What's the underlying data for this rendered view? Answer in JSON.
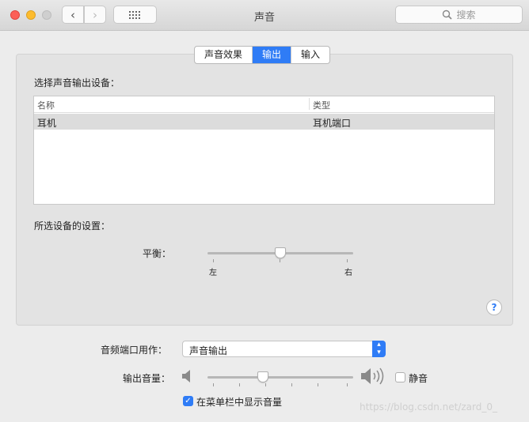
{
  "window": {
    "title": "声音"
  },
  "toolbar": {
    "back_icon": "‹",
    "forward_icon": "›",
    "grid_icon": "⋯",
    "search_placeholder": "搜索"
  },
  "tabs": [
    {
      "label": "声音效果",
      "active": false
    },
    {
      "label": "输出",
      "active": true
    },
    {
      "label": "输入",
      "active": false
    }
  ],
  "output": {
    "heading": "选择声音输出设备：",
    "columns": [
      "名称",
      "类型"
    ],
    "rows": [
      {
        "name": "耳机",
        "type": "耳机端口"
      }
    ]
  },
  "settings": {
    "heading": "所选设备的设置：",
    "balance_label": "平衡：",
    "balance_left": "左",
    "balance_right": "右",
    "balance_value": 0.5
  },
  "help": "?",
  "port": {
    "label": "音频端口用作：",
    "selected": "声音输出"
  },
  "volume": {
    "label": "输出音量：",
    "value": 0.4,
    "mute_label": "静音",
    "mute_checked": false
  },
  "menubar": {
    "label": "在菜单栏中显示音量",
    "checked": true
  },
  "watermark": "https://blog.csdn.net/zard_0_",
  "colors": {
    "accent": "#2f7cf6",
    "close": "#fc5f57",
    "minimize": "#fdbc2e",
    "maximize": "#cfcfcf"
  }
}
